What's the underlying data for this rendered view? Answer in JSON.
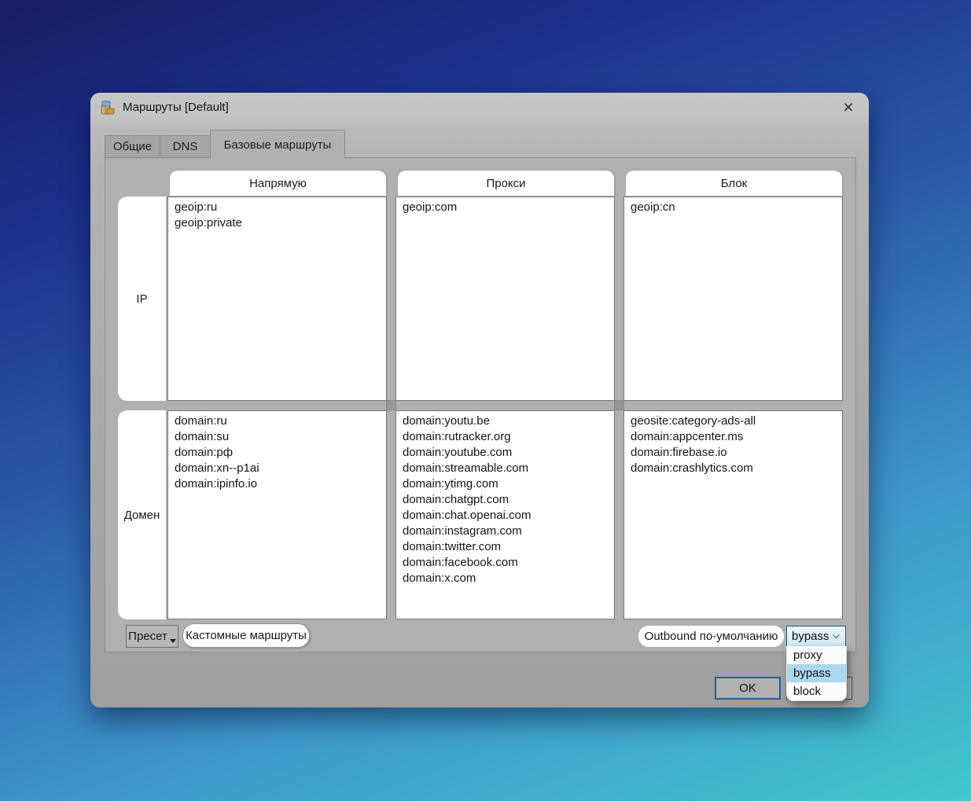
{
  "window": {
    "title": "Маршруты [Default]",
    "close": "×"
  },
  "tabs": [
    {
      "label": "Общие"
    },
    {
      "label": "DNS"
    },
    {
      "label": "Базовые маршруты"
    }
  ],
  "grid": {
    "column_headers": [
      "Напрямую",
      "Прокси",
      "Блок"
    ],
    "row_labels": [
      "IP",
      "Домен"
    ],
    "ip": {
      "direct": [
        "geoip:ru",
        "geoip:private"
      ],
      "proxy": [
        "geoip:com"
      ],
      "block": [
        "geoip:cn"
      ]
    },
    "domain": {
      "direct": [
        "domain:ru",
        "domain:su",
        "domain:рф",
        "domain:xn--p1ai",
        "domain:ipinfo.io"
      ],
      "proxy": [
        "domain:youtu.be",
        "domain:rutracker.org",
        "domain:youtube.com",
        "domain:streamable.com",
        "domain:ytimg.com",
        "domain:chatgpt.com",
        "domain:chat.openai.com",
        "domain:instagram.com",
        "domain:twitter.com",
        "domain:facebook.com",
        "domain:x.com"
      ],
      "block": [
        "geosite:category-ads-all",
        "domain:appcenter.ms",
        "domain:firebase.io",
        "domain:crashlytics.com"
      ]
    }
  },
  "footer": {
    "preset_button": "Пресет",
    "custom_routes_button": "Кастомные маршруты",
    "outbound_label": "Outbound по-умолчанию",
    "outbound_value": "bypass"
  },
  "dropdown": {
    "options": [
      "proxy",
      "bypass",
      "block"
    ],
    "selected": "bypass"
  },
  "dialog_buttons": {
    "ok": "OK"
  },
  "colors": {
    "accent_blue": "#2a5b97",
    "selection_blue": "#abd7f2",
    "dialog_gray": "#a9a9a9"
  }
}
